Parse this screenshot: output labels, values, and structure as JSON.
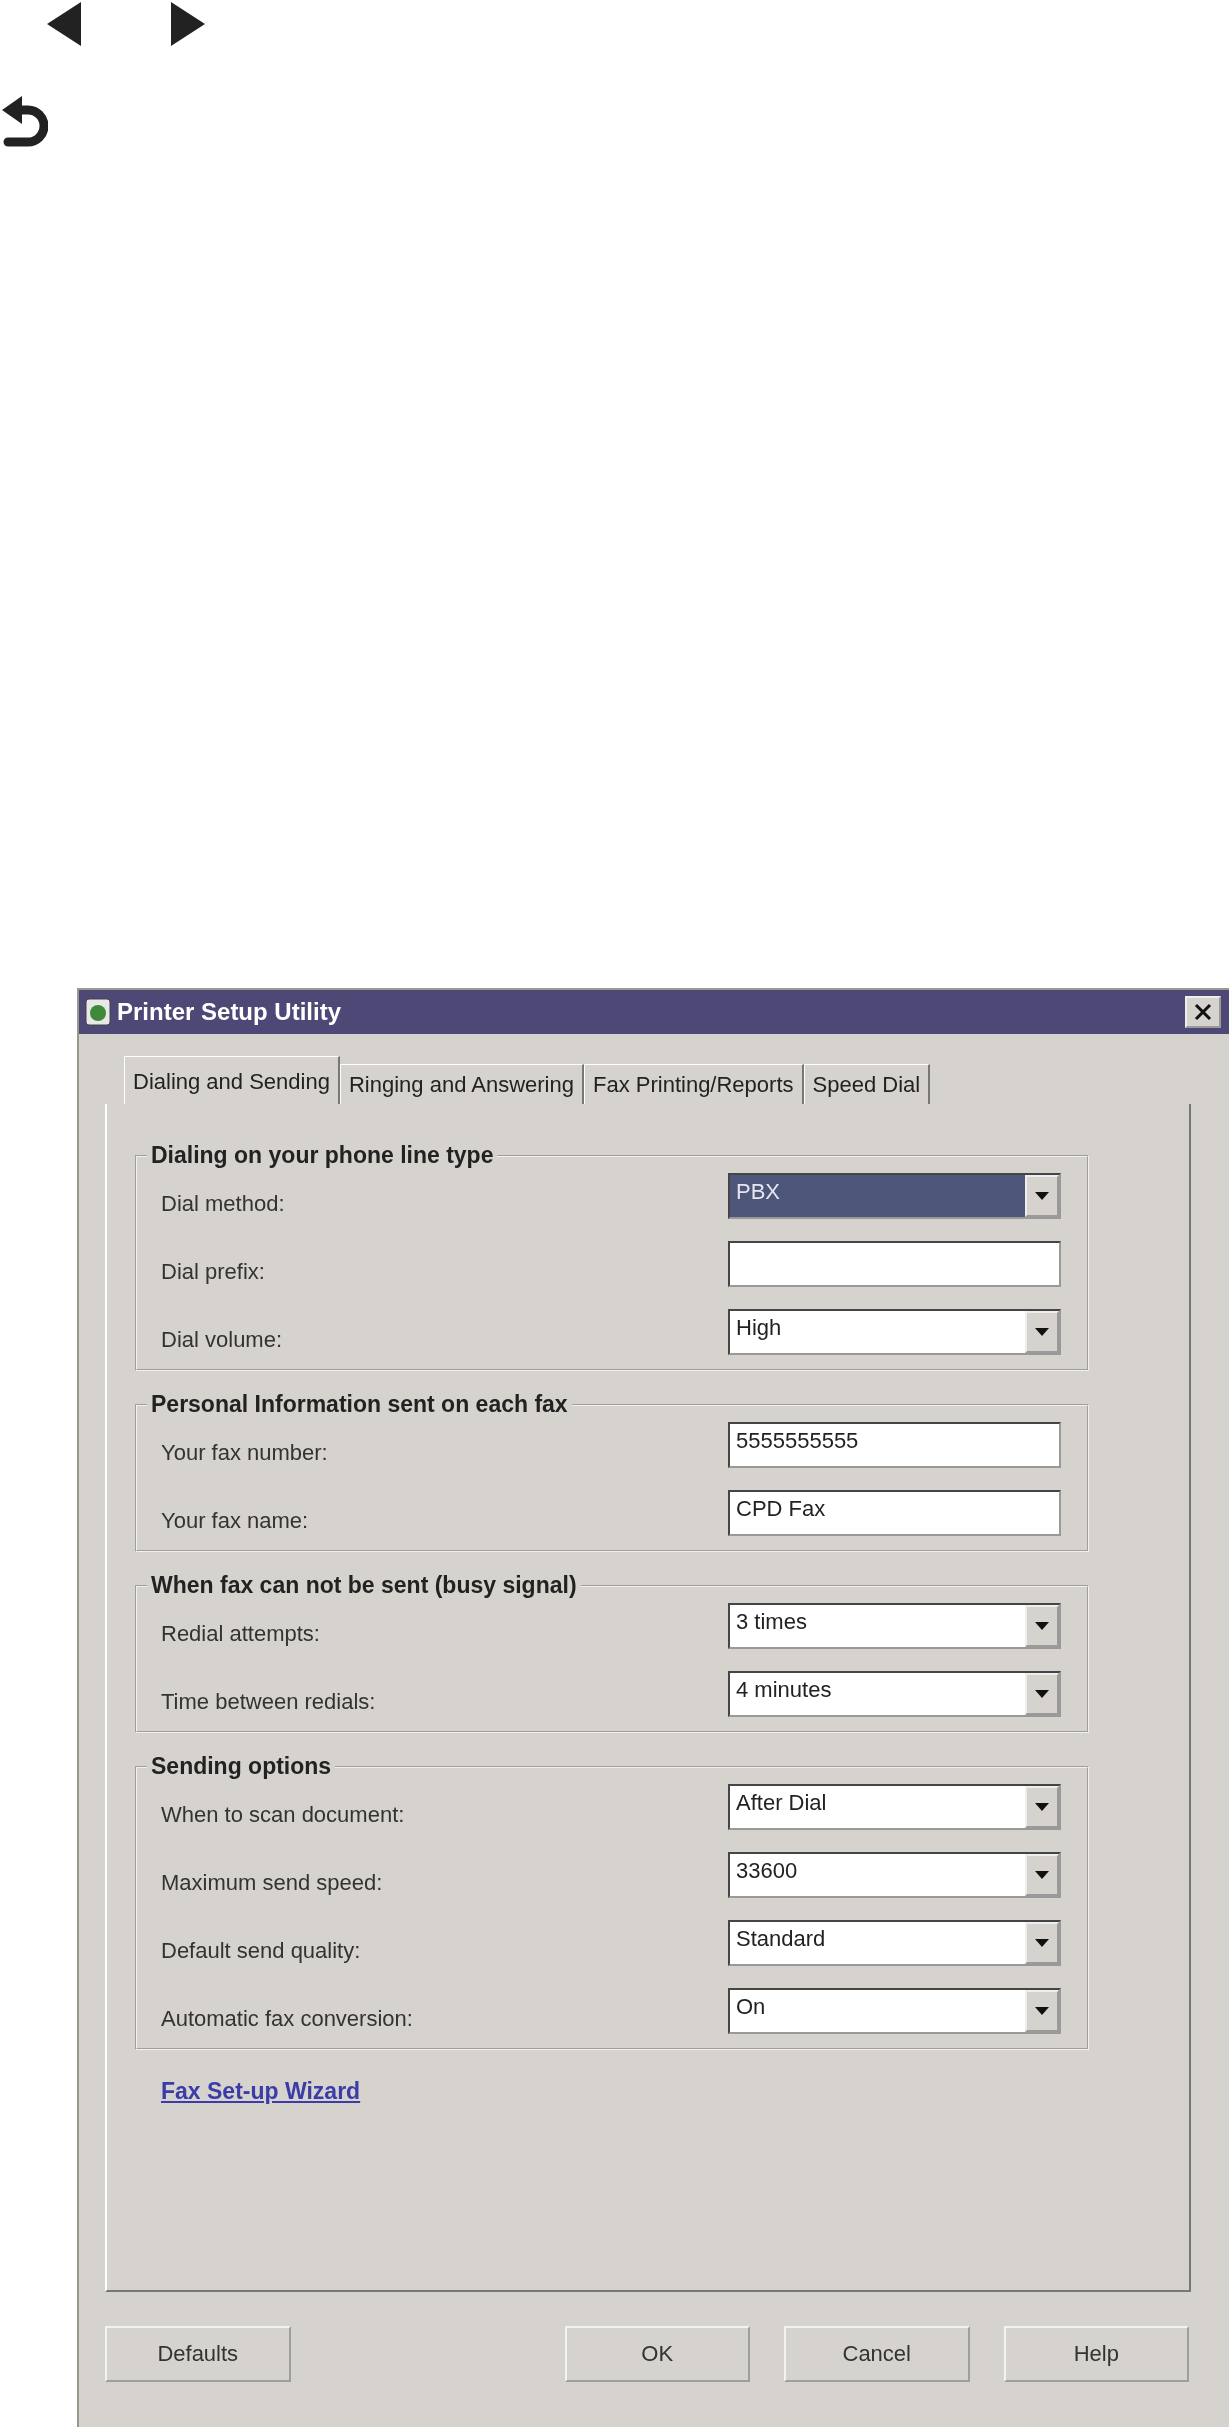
{
  "window": {
    "title": "Printer Setup Utility"
  },
  "tabs": [
    {
      "label": "Dialing and Sending",
      "selected": true
    },
    {
      "label": "Ringing and Answering",
      "selected": false
    },
    {
      "label": "Fax Printing/Reports",
      "selected": false
    },
    {
      "label": "Speed Dial",
      "selected": false
    }
  ],
  "groups": [
    {
      "title": "Dialing on your phone line type",
      "fields": [
        {
          "label": "Dial method:",
          "kind": "dropdown",
          "value": "PBX",
          "highlighted": true
        },
        {
          "label": "Dial prefix:",
          "kind": "text"
        },
        {
          "label": "Dial volume:",
          "kind": "dropdown",
          "value": "High",
          "highlighted": false
        }
      ]
    },
    {
      "title": "Personal Information sent on each fax",
      "fields": [
        {
          "label": "Your fax number:",
          "kind": "text",
          "value": "5555555555"
        },
        {
          "label": "Your fax name:",
          "kind": "text",
          "value": "CPD Fax"
        }
      ]
    },
    {
      "title": "When fax can not be sent (busy signal)",
      "fields": [
        {
          "label": "Redial attempts:",
          "kind": "dropdown",
          "value": "3 times",
          "highlighted": false
        },
        {
          "label": "Time between redials:",
          "kind": "dropdown",
          "value": "4 minutes",
          "highlighted": false
        }
      ]
    },
    {
      "title": "Sending options",
      "fields": [
        {
          "label": "When to scan document:",
          "kind": "dropdown",
          "value": "After Dial",
          "highlighted": false
        },
        {
          "label": "Maximum send speed:",
          "kind": "dropdown",
          "value": "33600",
          "highlighted": false
        },
        {
          "label": "Default send quality:",
          "kind": "dropdown",
          "value": "Standard",
          "highlighted": false
        },
        {
          "label": "Automatic fax conversion:",
          "kind": "dropdown",
          "value": "On",
          "highlighted": false
        }
      ]
    }
  ],
  "link": "Fax Set-up Wizard",
  "buttons": [
    "Defaults",
    "OK",
    "Cancel",
    "Help"
  ]
}
